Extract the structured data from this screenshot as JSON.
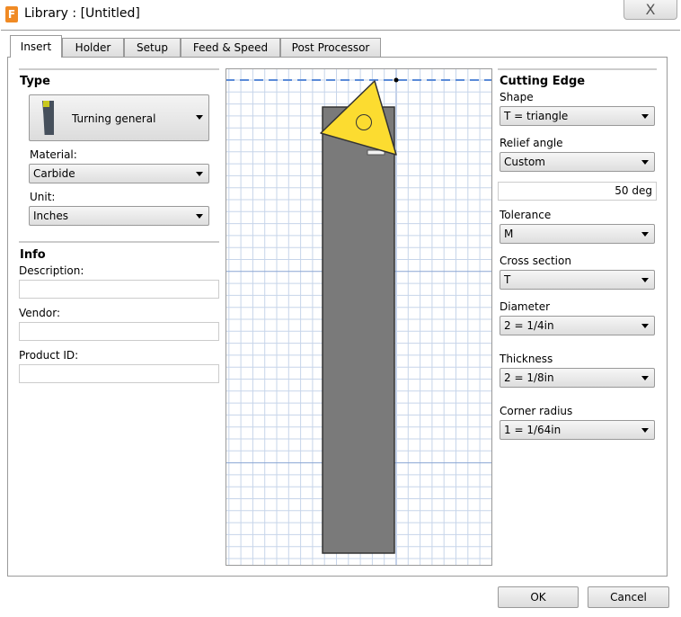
{
  "window": {
    "title": "Library :  [Untitled]",
    "close": "X"
  },
  "tabs": [
    "Insert",
    "Holder",
    "Setup",
    "Feed & Speed",
    "Post Processor"
  ],
  "type": {
    "heading": "Type",
    "selected": "Turning general",
    "material_label": "Material:",
    "material": "Carbide",
    "unit_label": "Unit:",
    "unit": "Inches"
  },
  "info": {
    "heading": "Info",
    "description_label": "Description:",
    "description": "",
    "vendor_label": "Vendor:",
    "vendor": "",
    "product_label": "Product ID:",
    "product": ""
  },
  "cutting": {
    "heading": "Cutting Edge",
    "shape_label": "Shape",
    "shape": "T = triangle",
    "relief_label": "Relief angle",
    "relief": "Custom",
    "relief_value": "50 deg",
    "tolerance_label": "Tolerance",
    "tolerance": "M",
    "cross_label": "Cross section",
    "cross": "T",
    "diameter_label": "Diameter",
    "diameter": "2 = 1/4in",
    "thickness_label": "Thickness",
    "thickness": "2 = 1/8in",
    "corner_label": "Corner radius",
    "corner": "1 = 1/64in"
  },
  "buttons": {
    "ok": "OK",
    "cancel": "Cancel"
  },
  "colors": {
    "insert": "#fcdc30",
    "holder": "#7a7a7a",
    "grid": "#c7d5ea",
    "axis": "#5b8bd8"
  }
}
